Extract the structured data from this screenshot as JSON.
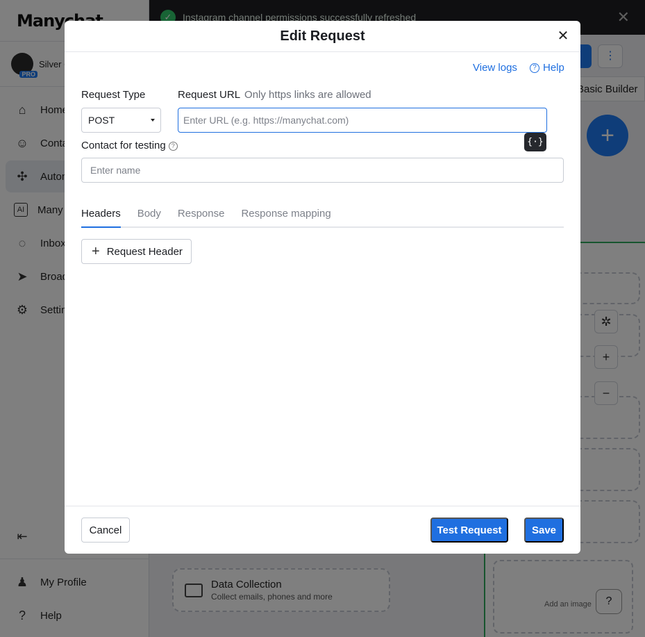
{
  "app": {
    "logo": "Manychat",
    "account_name": "Silver C",
    "account_badge": "PRO",
    "toast_message": "Instagram channel permissions successfully refreshed",
    "nav": [
      {
        "label": "Home",
        "icon": "home-icon"
      },
      {
        "label": "Conta",
        "icon": "contacts-icon"
      },
      {
        "label": "Autom",
        "icon": "automation-icon"
      },
      {
        "label": "Many",
        "icon": "ai-icon"
      },
      {
        "label": "Inbox",
        "icon": "inbox-icon"
      },
      {
        "label": "Broad",
        "icon": "broadcast-icon"
      },
      {
        "label": "Settin",
        "icon": "settings-icon"
      }
    ],
    "bottom_nav": [
      {
        "label": "My Profile",
        "icon": "profile-icon"
      },
      {
        "label": "Help",
        "icon": "help-icon"
      }
    ],
    "builder_toggle": "Basic Builder",
    "canvas_card": {
      "title": "Data Collection",
      "subtitle": "Collect emails, phones and more"
    },
    "image_placeholder": "Add an image",
    "accent_color": "#1f6fe0"
  },
  "modal": {
    "title": "Edit Request",
    "view_logs": "View logs",
    "help": "Help",
    "request_type_label": "Request Type",
    "request_type_value": "POST",
    "request_url_label": "Request URL",
    "request_url_hint": "Only https links are allowed",
    "request_url_placeholder": "Enter URL (e.g. https://manychat.com)",
    "request_url_value": "",
    "variable_button": "{·}",
    "contact_label": "Contact for testing",
    "contact_placeholder": "Enter name",
    "tabs": [
      {
        "label": "Headers",
        "active": true
      },
      {
        "label": "Body",
        "active": false
      },
      {
        "label": "Response",
        "active": false
      },
      {
        "label": "Response mapping",
        "active": false
      }
    ],
    "add_header_label": "Request Header",
    "cancel": "Cancel",
    "test_request": "Test Request",
    "save": "Save"
  }
}
